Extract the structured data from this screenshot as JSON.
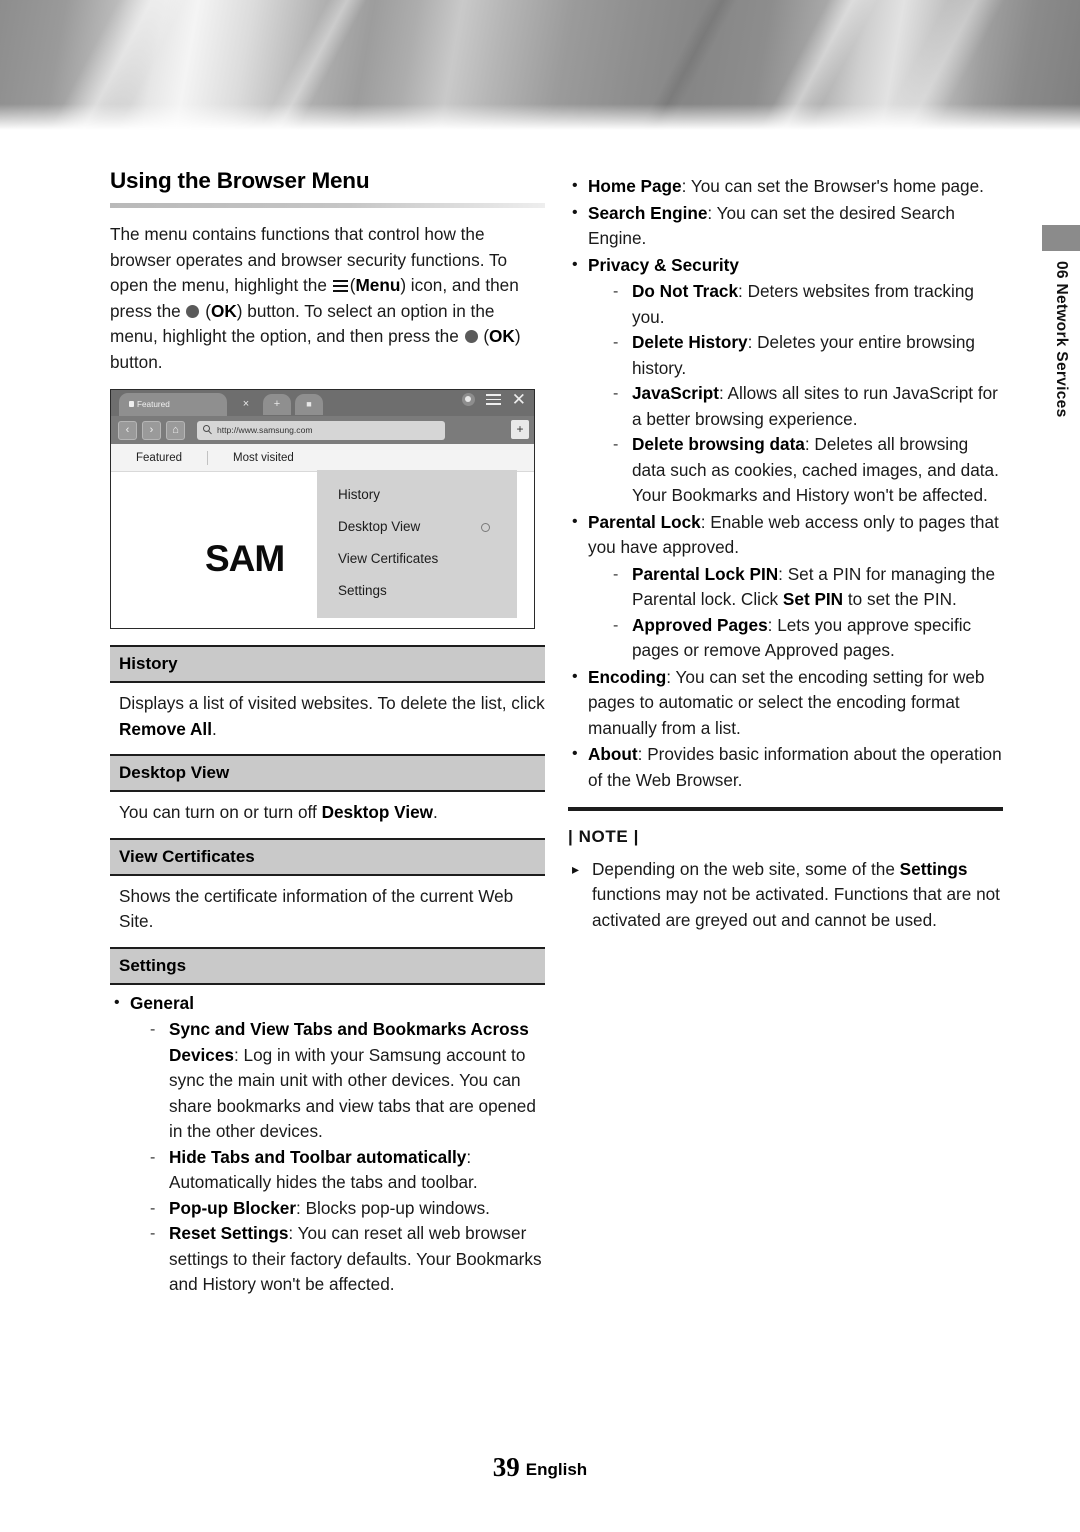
{
  "chapter_tab": {
    "number": "06",
    "title": "Network Services",
    "vertical_text": "06  Network Services"
  },
  "left_column": {
    "heading": "Using the Browser Menu",
    "intro": {
      "part1": "The menu contains functions that control how the browser operates and browser security functions. To open the menu, highlight the ",
      "menu_label": "Menu",
      "part2": ") icon, and then press the ",
      "ok_label": "OK",
      "part3": ") button. To select an option in the menu, highlight the option, and then press the ",
      "ok_label2": "OK",
      "part4": ") button."
    },
    "browser_mock": {
      "tab_label": "Featured",
      "close_glyph": "×",
      "new_tab_glyph": "+",
      "lock_glyph": "■",
      "url": "http://www.samsung.com",
      "plus_right": "+",
      "nav_back": "‹",
      "nav_forward": "›",
      "nav_home": "⌂",
      "subnav": [
        "Featured",
        "Most visited"
      ],
      "logo_text": "SAM",
      "menu_items": [
        {
          "label": "History",
          "radio": false
        },
        {
          "label": "Desktop View",
          "radio": true
        },
        {
          "label": "View Certificates",
          "radio": false
        },
        {
          "label": "Settings",
          "radio": false
        }
      ],
      "window_icons": [
        "avatar-icon",
        "hamburger-menu-icon",
        "close-icon"
      ]
    },
    "sections": [
      {
        "title": "History",
        "body_pre": "Displays a list of visited websites. To delete the list, click ",
        "body_bold": "Remove All",
        "body_post": "."
      },
      {
        "title": "Desktop View",
        "body_pre": "You can turn on or turn off ",
        "body_bold": "Desktop View",
        "body_post": "."
      },
      {
        "title": "View Certificates",
        "body_pre": "Shows the certificate information of the current Web Site.",
        "body_bold": "",
        "body_post": ""
      },
      {
        "title": "Settings",
        "body_pre": "",
        "body_bold": "",
        "body_post": ""
      }
    ],
    "settings_list": {
      "general_label": "General",
      "items": [
        {
          "term": "Sync and View Tabs and Bookmarks Across Devices",
          "desc": ": Log in with your Samsung account to sync the main unit with other devices. You can share bookmarks and view tabs that are opened in the other devices."
        },
        {
          "term": "Hide Tabs and Toolbar automatically",
          "desc": ": Automatically hides the tabs and toolbar."
        },
        {
          "term": "Pop-up Blocker",
          "desc": ": Blocks pop-up windows."
        },
        {
          "term": "Reset Settings",
          "desc": ": You can reset all web browser settings to their factory defaults. Your Bookmarks and History won't be affected."
        }
      ]
    }
  },
  "right_column": {
    "items": [
      {
        "term": "Home Page",
        "desc": ": You can set the Browser's home page."
      },
      {
        "term": "Search Engine",
        "desc": ": You can set the desired Search Engine."
      }
    ],
    "privacy": {
      "term": "Privacy & Security",
      "sub": [
        {
          "term": "Do Not Track",
          "desc": ": Deters websites from tracking you."
        },
        {
          "term": "Delete History",
          "desc": ": Deletes your entire browsing history."
        },
        {
          "term": "JavaScript",
          "desc": ": Allows all sites to run JavaScript for a better browsing experience."
        },
        {
          "term": "Delete browsing data",
          "desc": ": Deletes all browsing data such as cookies, cached images, and data. Your Bookmarks and History won't be affected."
        }
      ]
    },
    "parental": {
      "term": "Parental Lock",
      "desc": ": Enable web access only to pages that you have approved.",
      "sub": [
        {
          "term": "Parental Lock PIN",
          "desc_pre": ": Set a PIN for managing the Parental lock. Click ",
          "desc_bold": "Set PIN",
          "desc_post": " to set the PIN."
        },
        {
          "term": "Approved Pages",
          "desc_pre": ": Lets you approve specific pages or remove Approved pages.",
          "desc_bold": "",
          "desc_post": ""
        }
      ]
    },
    "tail_items": [
      {
        "term": "Encoding",
        "desc": ": You can set the encoding setting for web pages to automatic or select the encoding format manually from a list."
      },
      {
        "term": "About",
        "desc": ": Provides basic information about the operation of the Web Browser."
      }
    ],
    "note": {
      "label": "| NOTE |",
      "body_pre": "Depending on the web site, some of the ",
      "body_bold": "Settings",
      "body_post": " functions may not be activated. Functions that are not activated are greyed out and cannot be used."
    }
  },
  "footer": {
    "page_number": "39",
    "language": "English"
  },
  "colors": {
    "header_rule": "#c6c6c6",
    "box_header_bg": "#c9c9c9",
    "box_border": "#1d1d1d",
    "tab_gray": "#8b8b8b"
  }
}
